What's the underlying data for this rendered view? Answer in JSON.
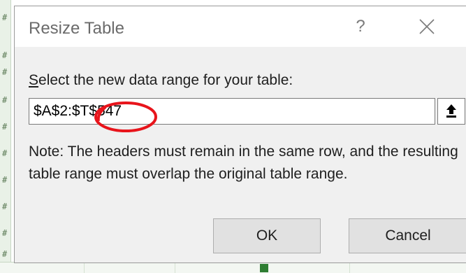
{
  "dialog": {
    "title": "Resize Table",
    "help_label": "?",
    "prompt_label_underlined": "S",
    "prompt_label_rest": "elect the new data range for your table:",
    "range_value": "$A$2:$T$547",
    "note": "Note: The headers must remain in the same row, and the resulting table range must overlap the original table range.",
    "ok_label": "OK",
    "cancel_label": "Cancel"
  },
  "icons": {
    "help": "question-icon",
    "close": "close-icon",
    "collapse": "collapse-dialog-icon"
  },
  "colors": {
    "dialog_bg": "#f0f0f0",
    "annotation_red": "#e8141b",
    "sheet_green": "#e9f1e7"
  }
}
